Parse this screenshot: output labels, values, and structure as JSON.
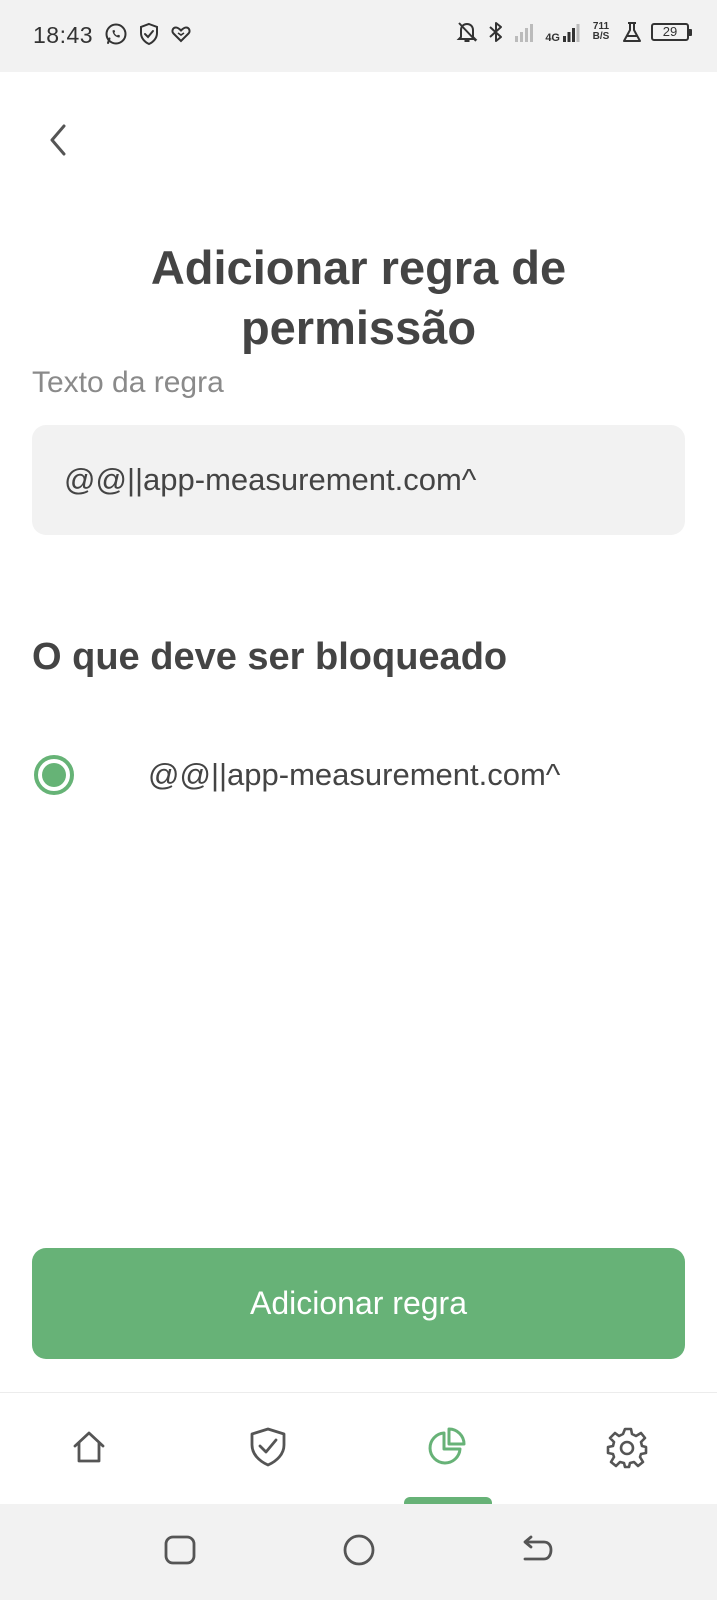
{
  "status_bar": {
    "time": "18:43",
    "network_type": "4G",
    "network_speed_value": "711",
    "network_speed_unit": "B/S",
    "battery_level": "29",
    "left_icons": [
      "whatsapp-icon",
      "shield-check-icon",
      "heart-icon"
    ],
    "right_icons": [
      "bell-off-icon",
      "bluetooth-icon",
      "signal-icon",
      "signal-4g-icon",
      "flask-icon",
      "battery-icon"
    ]
  },
  "header": {
    "back_icon": "chevron-left-icon",
    "title": "Adicionar regra de permissão"
  },
  "form": {
    "rule_text_label": "Texto da regra",
    "rule_text_value": "@@||app-measurement.com^"
  },
  "block_section": {
    "heading": "O que deve ser bloqueado",
    "options": [
      {
        "label": "@@||app-measurement.com^",
        "selected": true
      }
    ]
  },
  "actions": {
    "add_rule_label": "Adicionar regra"
  },
  "bottom_nav": {
    "items": [
      {
        "icon": "home-icon",
        "active": false
      },
      {
        "icon": "shield-check-icon",
        "active": false
      },
      {
        "icon": "pie-chart-icon",
        "active": true
      },
      {
        "icon": "gear-icon",
        "active": false
      }
    ]
  },
  "system_nav": {
    "items": [
      "recent-apps-icon",
      "home-circle-icon",
      "back-arrow-icon"
    ]
  },
  "colors": {
    "accent": "#67b277",
    "text_primary": "#444444",
    "text_secondary": "#8a8a8a",
    "input_background": "#f2f2f2"
  }
}
